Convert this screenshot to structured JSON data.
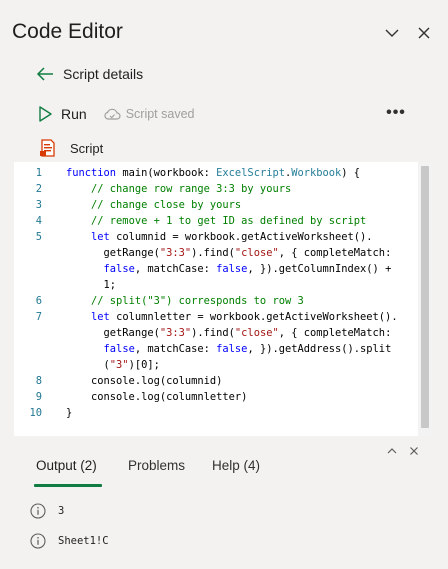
{
  "header": {
    "title": "Code Editor",
    "collapse_icon": "chevron-down-icon",
    "close_icon": "close-icon"
  },
  "nav": {
    "back_label": "Script details",
    "back_icon": "arrow-left-icon"
  },
  "toolbar": {
    "run_label": "Run",
    "run_icon": "play-icon",
    "saved_label": "Script saved",
    "saved_icon": "cloud-sync-icon",
    "more_label": "•••"
  },
  "script": {
    "label": "Script",
    "icon": "script-file-icon",
    "accent_color": "#d83b01"
  },
  "code": {
    "line_numbers": [
      "1",
      "2",
      "3",
      "4",
      "5",
      "6",
      "7",
      "8",
      "9",
      "10"
    ],
    "lines": [
      {
        "num": "1",
        "tokens": [
          [
            "kw",
            "function "
          ],
          [
            "tx",
            "main(workbook: "
          ],
          [
            "tp",
            "ExcelScript"
          ],
          [
            "tx",
            "."
          ],
          [
            "tp",
            "Workbook"
          ],
          [
            "tx",
            ") {"
          ]
        ]
      },
      {
        "num": "2",
        "tokens": [
          [
            "tx",
            "    "
          ],
          [
            "cm",
            "// change row range 3:3 by yours"
          ]
        ]
      },
      {
        "num": "3",
        "tokens": [
          [
            "tx",
            "    "
          ],
          [
            "cm",
            "// change close by yours"
          ]
        ]
      },
      {
        "num": "4",
        "tokens": [
          [
            "tx",
            "    "
          ],
          [
            "cm",
            "// remove + 1 to get ID as defined by script"
          ]
        ]
      },
      {
        "num": "5",
        "tokens": [
          [
            "tx",
            "    "
          ],
          [
            "kw",
            "let "
          ],
          [
            "tx",
            "columnid = workbook.getActiveWorksheet()."
          ]
        ]
      },
      {
        "num": "",
        "tokens": [
          [
            "tx",
            "      getRange("
          ],
          [
            "str",
            "\"3:3\""
          ],
          [
            "tx",
            ").find("
          ],
          [
            "str",
            "\"close\""
          ],
          [
            "tx",
            ", { completeMatch:"
          ]
        ]
      },
      {
        "num": "",
        "tokens": [
          [
            "tx",
            "      "
          ],
          [
            "kw",
            "false"
          ],
          [
            "tx",
            ", matchCase: "
          ],
          [
            "kw",
            "false"
          ],
          [
            "tx",
            ", }).getColumnIndex() +"
          ]
        ]
      },
      {
        "num": "",
        "tokens": [
          [
            "tx",
            "      1;"
          ]
        ]
      },
      {
        "num": "6",
        "tokens": [
          [
            "tx",
            "    "
          ],
          [
            "cm",
            "// split(\"3\") corresponds to row 3"
          ]
        ]
      },
      {
        "num": "7",
        "tokens": [
          [
            "tx",
            "    "
          ],
          [
            "kw",
            "let "
          ],
          [
            "tx",
            "columnletter = workbook.getActiveWorksheet()."
          ]
        ]
      },
      {
        "num": "",
        "tokens": [
          [
            "tx",
            "      getRange("
          ],
          [
            "str",
            "\"3:3\""
          ],
          [
            "tx",
            ").find("
          ],
          [
            "str",
            "\"close\""
          ],
          [
            "tx",
            ", { completeMatch:"
          ]
        ]
      },
      {
        "num": "",
        "tokens": [
          [
            "tx",
            "      "
          ],
          [
            "kw",
            "false"
          ],
          [
            "tx",
            ", matchCase: "
          ],
          [
            "kw",
            "false"
          ],
          [
            "tx",
            ", }).getAddress().split"
          ]
        ]
      },
      {
        "num": "",
        "tokens": [
          [
            "tx",
            "      ("
          ],
          [
            "str",
            "\"3\""
          ],
          [
            "tx",
            ")[0];"
          ]
        ]
      },
      {
        "num": "8",
        "tokens": [
          [
            "tx",
            "    console.log(columnid)"
          ]
        ]
      },
      {
        "num": "9",
        "tokens": [
          [
            "tx",
            "    console.log(columnletter)"
          ]
        ]
      },
      {
        "num": "10",
        "tokens": [
          [
            "tx",
            "}"
          ]
        ]
      }
    ]
  },
  "output_panel": {
    "tabs": [
      {
        "label": "Output (2)",
        "active": true
      },
      {
        "label": "Problems",
        "active": false
      },
      {
        "label": "Help (4)",
        "active": false
      }
    ],
    "rows": [
      {
        "icon": "info-icon",
        "text": "3"
      },
      {
        "icon": "info-icon",
        "text": "Sheet1!C"
      }
    ],
    "accent_color": "#107c41"
  }
}
